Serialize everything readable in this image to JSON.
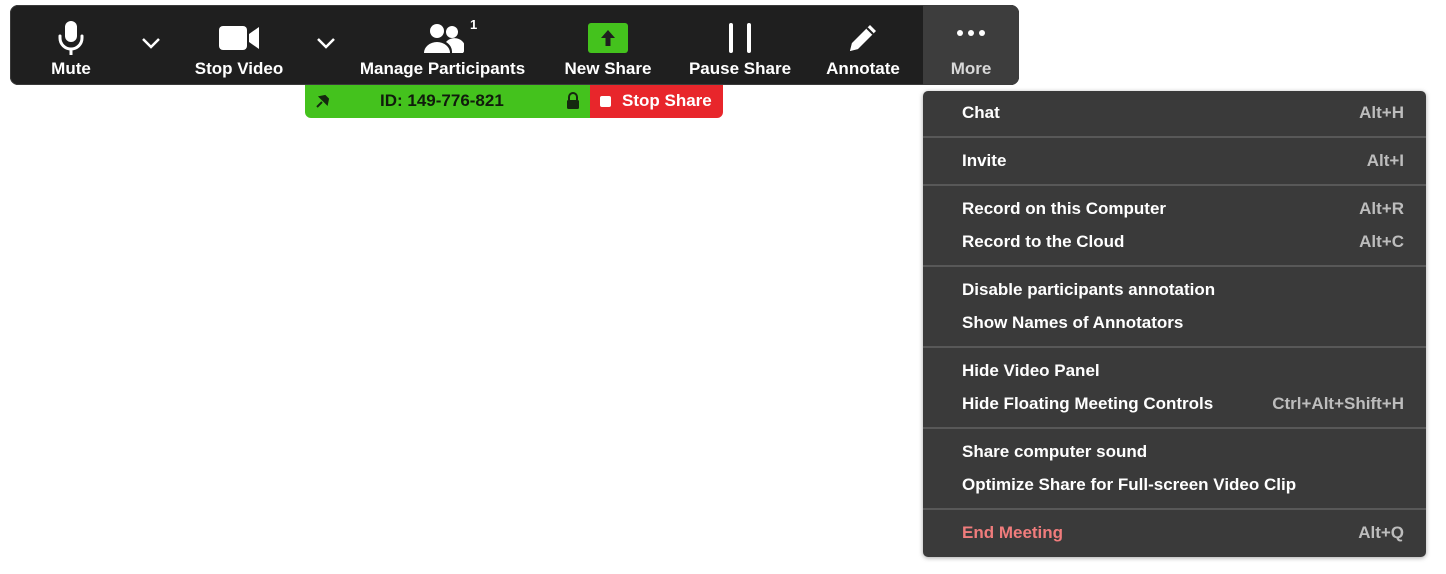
{
  "toolbar": {
    "mute_label": "Mute",
    "stop_video_label": "Stop Video",
    "manage_participants_label": "Manage Participants",
    "participant_count": "1",
    "new_share_label": "New Share",
    "pause_share_label": "Pause Share",
    "annotate_label": "Annotate",
    "more_label": "More"
  },
  "sharebar": {
    "meeting_id": "ID: 149-776-821",
    "stop_share_label": "Stop Share"
  },
  "menu": {
    "items": [
      {
        "label": "Chat",
        "shortcut": "Alt+H"
      },
      {
        "label": "Invite",
        "shortcut": "Alt+I"
      },
      {
        "label": "Record on this Computer",
        "shortcut": "Alt+R"
      },
      {
        "label": "Record to the Cloud",
        "shortcut": "Alt+C"
      },
      {
        "label": "Disable participants annotation",
        "shortcut": ""
      },
      {
        "label": "Show Names of Annotators",
        "shortcut": ""
      },
      {
        "label": "Hide Video Panel",
        "shortcut": ""
      },
      {
        "label": "Hide Floating Meeting Controls",
        "shortcut": "Ctrl+Alt+Shift+H"
      },
      {
        "label": "Share computer sound",
        "shortcut": ""
      },
      {
        "label": "Optimize Share for Full-screen Video Clip",
        "shortcut": ""
      },
      {
        "label": "End Meeting",
        "shortcut": "Alt+Q"
      }
    ]
  },
  "colors": {
    "toolbar_bg": "#1f1f1f",
    "menu_bg": "#3a3a3a",
    "share_green": "#44c21d",
    "stop_red": "#e8262b",
    "danger_text": "#f07c7c"
  },
  "icons": {
    "mute": "microphone-icon",
    "video": "video-camera-icon",
    "participants": "participants-icon",
    "new_share": "upload-arrow-icon",
    "pause_share": "pause-icon",
    "annotate": "pencil-icon",
    "more": "ellipsis-icon",
    "pin": "pin-icon",
    "lock": "lock-icon"
  }
}
